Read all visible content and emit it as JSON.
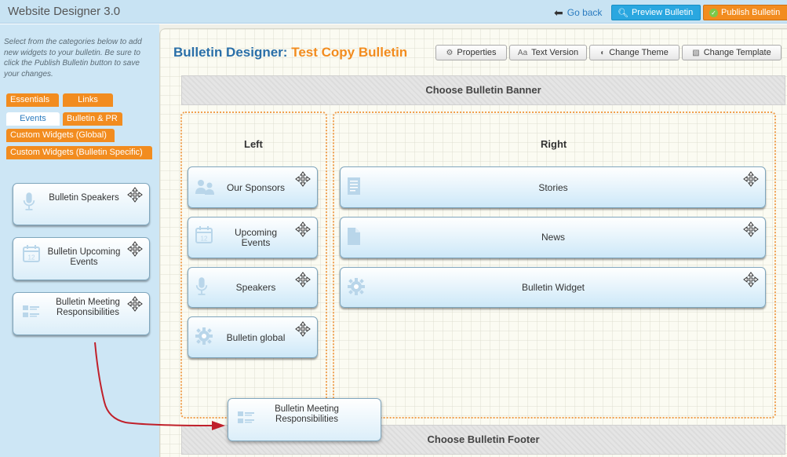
{
  "app": {
    "title": "Website Designer 3.0"
  },
  "topbar": {
    "go_back": "Go back",
    "preview": "Preview Bulletin",
    "publish": "Publish Bulletin"
  },
  "sidebar": {
    "instructions": "Select from the categories below to add new widgets to your bulletin. Be sure to click the Publish Bulletin button to save your changes.",
    "categories": [
      "Essentials",
      "Links",
      "Events",
      "Bulletin & PR",
      "Custom Widgets (Global)",
      "Custom Widgets (Bulletin Specific)"
    ],
    "active_category": "Events",
    "widgets": [
      {
        "label": "Bulletin Speakers",
        "icon": "microphone-icon"
      },
      {
        "label": "Bulletin Upcoming Events",
        "icon": "calendar-icon"
      },
      {
        "label": "Bulletin Meeting Responsibilities",
        "icon": "list-icon"
      }
    ]
  },
  "designer": {
    "title_prefix": "Bulletin Designer:",
    "bulletin_name": "Test Copy Bulletin",
    "toolbar": {
      "properties": "Properties",
      "text_version": "Text Version",
      "change_theme": "Change Theme",
      "change_template": "Change Template"
    },
    "banner": "Choose Bulletin Banner",
    "footer": "Choose Bulletin Footer",
    "left_column": {
      "title": "Left",
      "widgets": [
        {
          "label": "Our Sponsors",
          "icon": "people-icon"
        },
        {
          "label": "Upcoming Events",
          "icon": "calendar-icon"
        },
        {
          "label": "Speakers",
          "icon": "microphone-icon"
        },
        {
          "label": "Bulletin global",
          "icon": "gears-icon"
        }
      ]
    },
    "right_column": {
      "title": "Right",
      "widgets": [
        {
          "label": "Stories",
          "icon": "document-icon"
        },
        {
          "label": "News",
          "icon": "news-icon"
        },
        {
          "label": "Bulletin Widget",
          "icon": "gear-icon"
        }
      ]
    },
    "dragging_widget": {
      "label": "Bulletin Meeting Responsibilities",
      "icon": "list-icon"
    }
  },
  "colors": {
    "accent_blue": "#2a7bbf",
    "accent_orange": "#f28c1f",
    "sidebar_bg": "#cde6f5",
    "arrow": "#c0202a"
  }
}
